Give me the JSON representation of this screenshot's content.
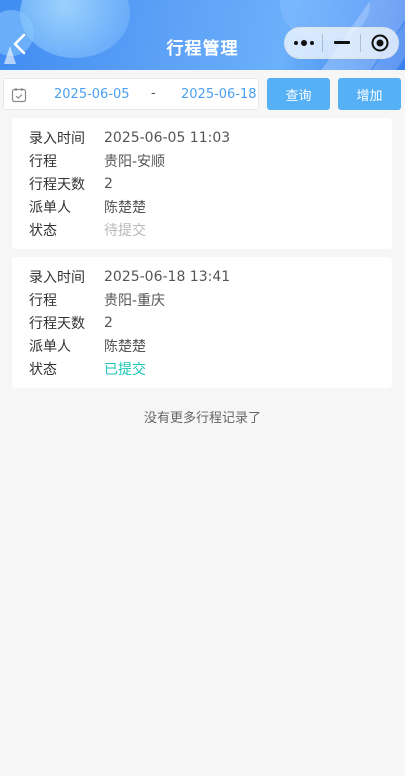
{
  "header": {
    "title": "行程管理"
  },
  "filter": {
    "start_date": "2025-06-05",
    "separator": "-",
    "end_date": "2025-06-18",
    "query_label": "查询",
    "add_label": "增加"
  },
  "records": [
    {
      "entry_time_label": "录入时间",
      "entry_time": "2025-06-05 11:03",
      "route_label": "行程",
      "route": "贵阳-安顺",
      "days_label": "行程天数",
      "days": "2",
      "dispatcher_label": "派单人",
      "dispatcher": "陈楚楚",
      "status_label": "状态",
      "status": "待提交",
      "status_color": "#b8b8b8"
    },
    {
      "entry_time_label": "录入时间",
      "entry_time": "2025-06-18 13:41",
      "route_label": "行程",
      "route": "贵阳-重庆",
      "days_label": "行程天数",
      "days": "2",
      "dispatcher_label": "派单人",
      "dispatcher": "陈楚楚",
      "status_label": "状态",
      "status": "已提交",
      "status_color": "#19c6b5"
    }
  ],
  "footer": {
    "no_more_text": "没有更多行程记录了"
  },
  "theme": {
    "accent": "#55b0f5",
    "date_text": "#4a9ff0",
    "header_gradient_start": "#3f8cf2",
    "header_gradient_end": "#6ab0fa"
  },
  "icons": {
    "back": "chevron-left-icon",
    "more": "more-dots-icon",
    "minimize": "minimize-icon",
    "close": "target-circle-icon",
    "calendar": "calendar-check-icon"
  }
}
